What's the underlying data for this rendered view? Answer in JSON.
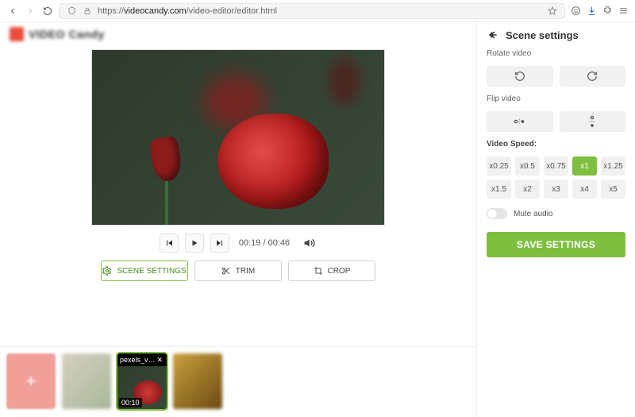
{
  "browser": {
    "url_prefix": "https://",
    "url_domain": "videocandy.com",
    "url_path": "/video-editor/editor.html"
  },
  "header": {
    "brand": "VIDEO Candy"
  },
  "player": {
    "current_time": "00:19",
    "total_time": "00:46"
  },
  "actions": {
    "scene_settings": "SCENE SETTINGS",
    "trim": "TRIM",
    "crop": "CROP"
  },
  "timeline": {
    "selected_clip": {
      "name": "pexels_v…",
      "duration": "00:10"
    }
  },
  "panel": {
    "title": "Scene settings",
    "rotate_label": "Rotate video",
    "flip_label": "Flip video",
    "speed_label": "Video Speed:",
    "speed_options": [
      "x0.25",
      "x0.5",
      "x0.75",
      "x1",
      "x1.25",
      "x1.5",
      "x2",
      "x3",
      "x4",
      "x5"
    ],
    "speed_selected": "x1",
    "mute_label": "Mute audio",
    "save_label": "SAVE SETTINGS",
    "colors": {
      "accent": "#7fbf3f"
    }
  }
}
